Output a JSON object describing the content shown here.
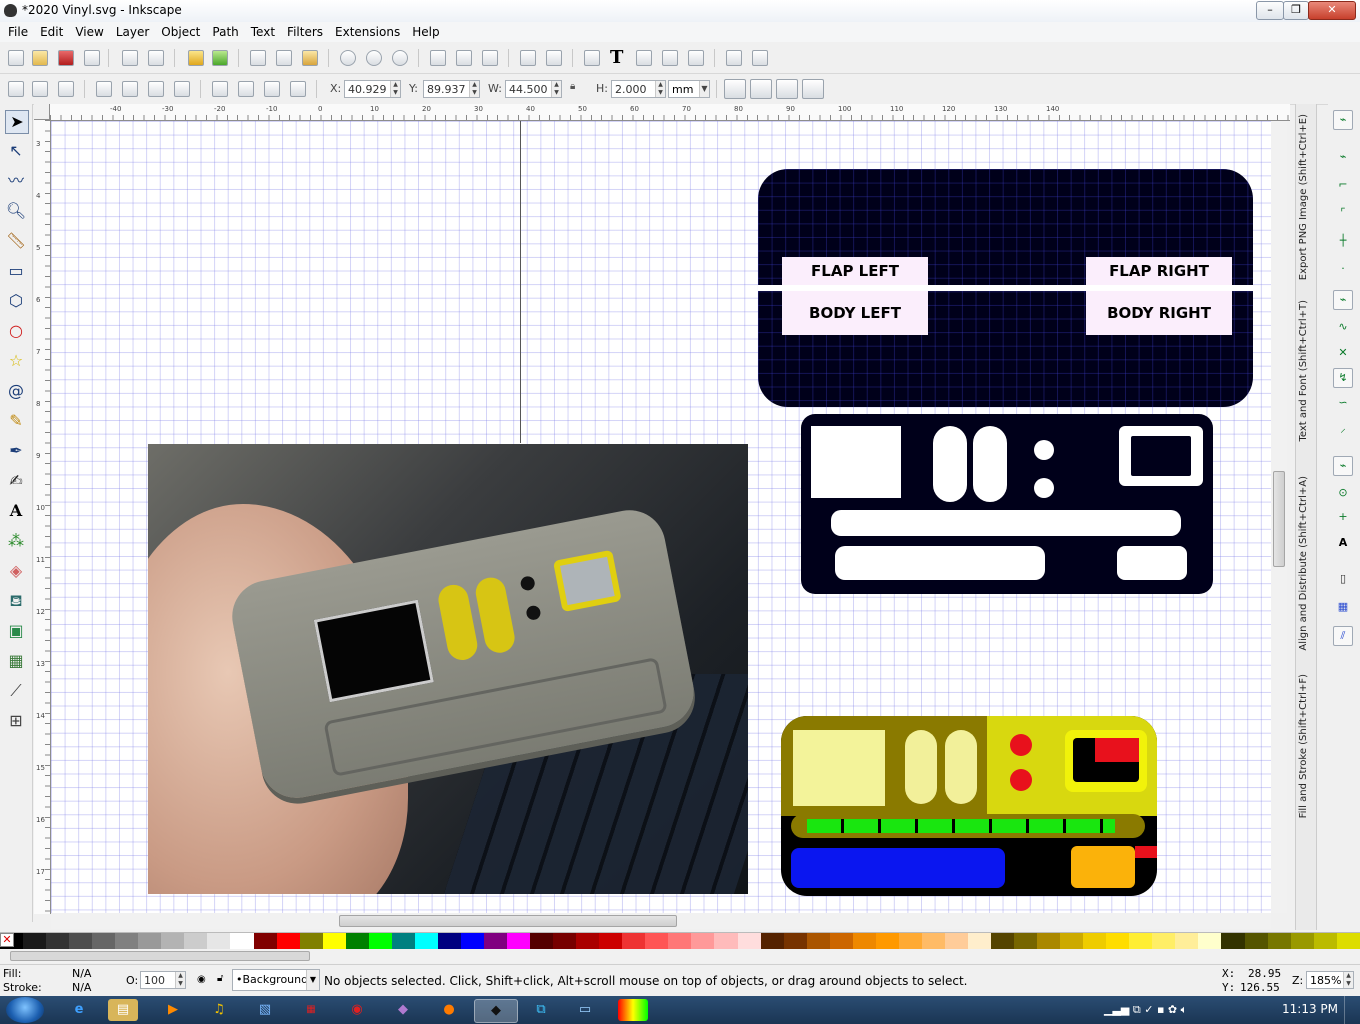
{
  "window": {
    "title": "*2020 Vinyl.svg - Inkscape",
    "minimize": "–",
    "maximize": "❐",
    "close": "✕"
  },
  "menu": [
    "File",
    "Edit",
    "View",
    "Layer",
    "Object",
    "Path",
    "Text",
    "Filters",
    "Extensions",
    "Help"
  ],
  "selector_toolbar": {
    "x_label": "X:",
    "x_value": "40.929",
    "y_label": "Y:",
    "y_value": "89.937",
    "w_label": "W:",
    "w_value": "44.500",
    "h_label": "H:",
    "h_value": "2.000",
    "unit": "mm"
  },
  "artwork": {
    "flap_left": "FLAP LEFT",
    "flap_right": "FLAP RIGHT",
    "body_left": "BODY LEFT",
    "body_right": "BODY RIGHT",
    "colors": {
      "black": "#000000",
      "navy": "#00001a",
      "label_bg": "#fbeefc",
      "yellow": "#f1f20a",
      "olive": "#8a7a00",
      "green": "#19e60f",
      "red": "#e8111c",
      "blue": "#0a16f0",
      "orange": "#fbb20a"
    }
  },
  "dock_tabs": [
    "Export PNG Image (Shift+Ctrl+E)",
    "Text and Font (Shift+Ctrl+T)",
    "Align and Distribute (Shift+Ctrl+A)",
    "Fill and Stroke (Shift+Ctrl+F)"
  ],
  "rulers": {
    "h": [
      "-40",
      "-30",
      "-20",
      "-10",
      "0",
      "10",
      "20",
      "30",
      "40",
      "50",
      "60",
      "70",
      "80",
      "90",
      "100",
      "110",
      "120",
      "130",
      "140"
    ],
    "v": [
      "3",
      "4",
      "5",
      "6",
      "7",
      "8",
      "9",
      "10",
      "11",
      "12",
      "13",
      "14",
      "15",
      "16",
      "17"
    ]
  },
  "status": {
    "fill_label": "Fill:",
    "fill_value": "N/A",
    "stroke_label": "Stroke:",
    "stroke_value": "N/A",
    "opacity_label": "O:",
    "opacity_value": "100",
    "layer": "•Background",
    "message": "No objects selected. Click, Shift+click, Alt+scroll mouse on top of objects, or drag around objects to select.",
    "cursor_x_label": "X:",
    "cursor_x": "28.95",
    "cursor_y_label": "Y:",
    "cursor_y": "126.55",
    "zoom_label": "Z:",
    "zoom": "185%"
  },
  "taskbar": {
    "clock": "11:13 PM"
  }
}
